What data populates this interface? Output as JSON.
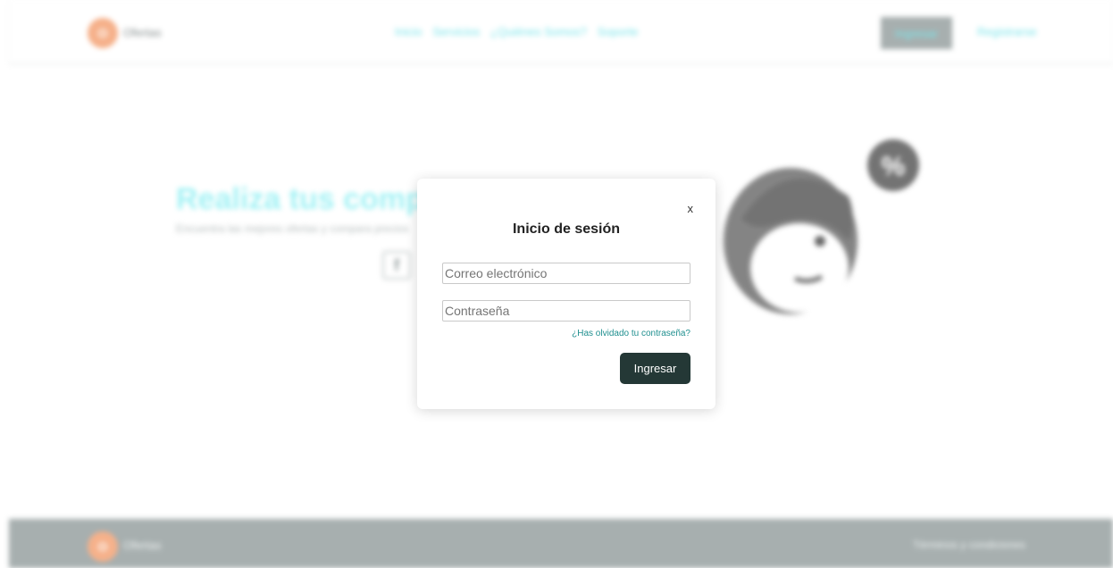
{
  "brand": {
    "logo_letter": "O",
    "name": "Ofertas"
  },
  "nav": {
    "items": [
      "Inicio",
      "Servicios",
      "¿Quiénes Somos?",
      "Soporte"
    ],
    "login_button": "Ingresar",
    "register_link": "Registrarse"
  },
  "hero": {
    "title": "Realiza tus compras",
    "subtitle": "Encuentra las mejores ofertas y compara precios"
  },
  "footer": {
    "brand_name": "Ofertas",
    "terms_link": "Términos y condiciones"
  },
  "modal": {
    "close_label": "x",
    "title": "Inicio de sesión",
    "email_placeholder": "Correo electrónico",
    "password_placeholder": "Contraseña",
    "forgot_link": "¿Has olvidado tu contraseña?",
    "submit_label": "Ingresar"
  },
  "colors": {
    "brand_orange": "#f4a071",
    "accent_cyan": "#5fe0e6",
    "button_dark": "#243836",
    "link_teal": "#1f8f8f",
    "footer_gray": "#949e9e"
  }
}
